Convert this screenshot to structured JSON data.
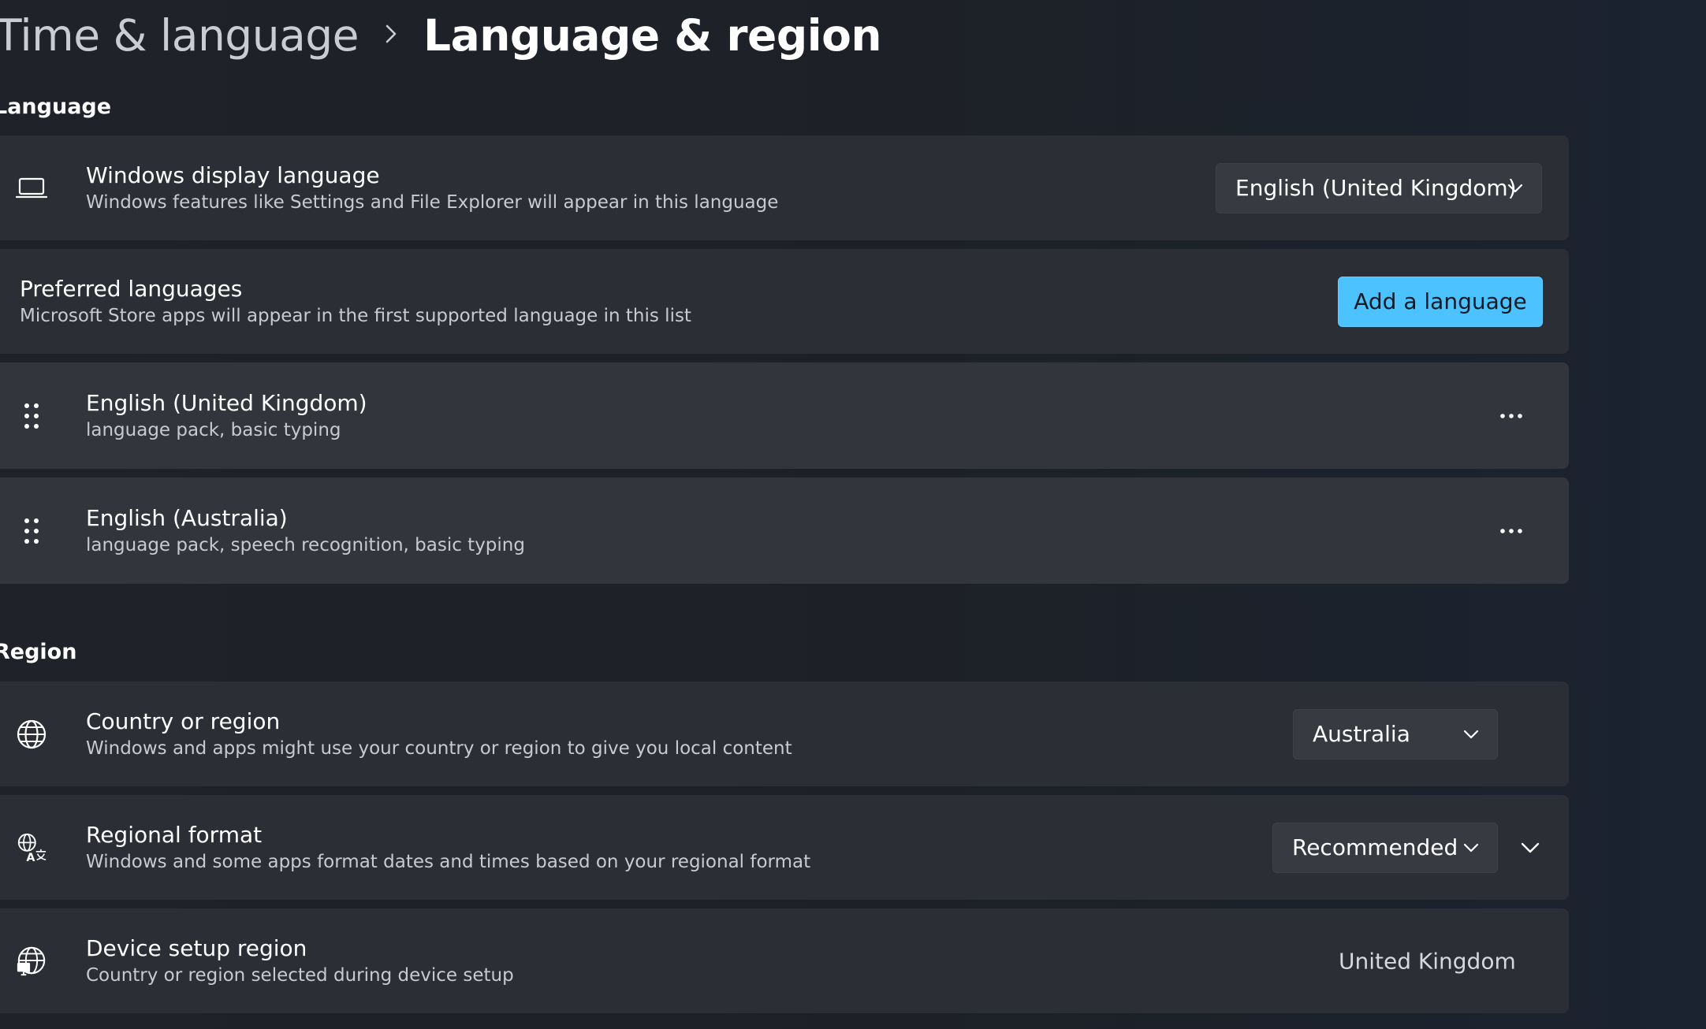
{
  "breadcrumb": {
    "parent": "Time & language",
    "separator": "›",
    "current": "Language & region"
  },
  "language_section": {
    "heading": "Language",
    "display_language": {
      "icon": "laptop-icon",
      "title": "Windows display language",
      "description": "Windows features like Settings and File Explorer will appear in this language",
      "selected": "English (United Kingdom)"
    },
    "preferred": {
      "title": "Preferred languages",
      "description": "Microsoft Store apps will appear in the first supported language in this list",
      "add_button": "Add a language"
    },
    "languages": [
      {
        "name": "English (United Kingdom)",
        "features": "language pack, basic typing"
      },
      {
        "name": "English (Australia)",
        "features": "language pack, speech recognition, basic typing"
      }
    ]
  },
  "region_section": {
    "heading": "Region",
    "country": {
      "icon": "globe-icon",
      "title": "Country or region",
      "description": "Windows and apps might use your country or region to give you local content",
      "selected": "Australia"
    },
    "format": {
      "icon": "regional-format-icon",
      "title": "Regional format",
      "description": "Windows and some apps format dates and times based on your regional format",
      "selected": "Recommended"
    },
    "device_region": {
      "icon": "globe-device-icon",
      "title": "Device setup region",
      "description": "Country or region selected during device setup",
      "value": "United Kingdom"
    }
  },
  "colors": {
    "accent": "#4cc2ff",
    "card": "#2b2f35",
    "sub_card": "#32363c",
    "background": "#1f2329"
  }
}
